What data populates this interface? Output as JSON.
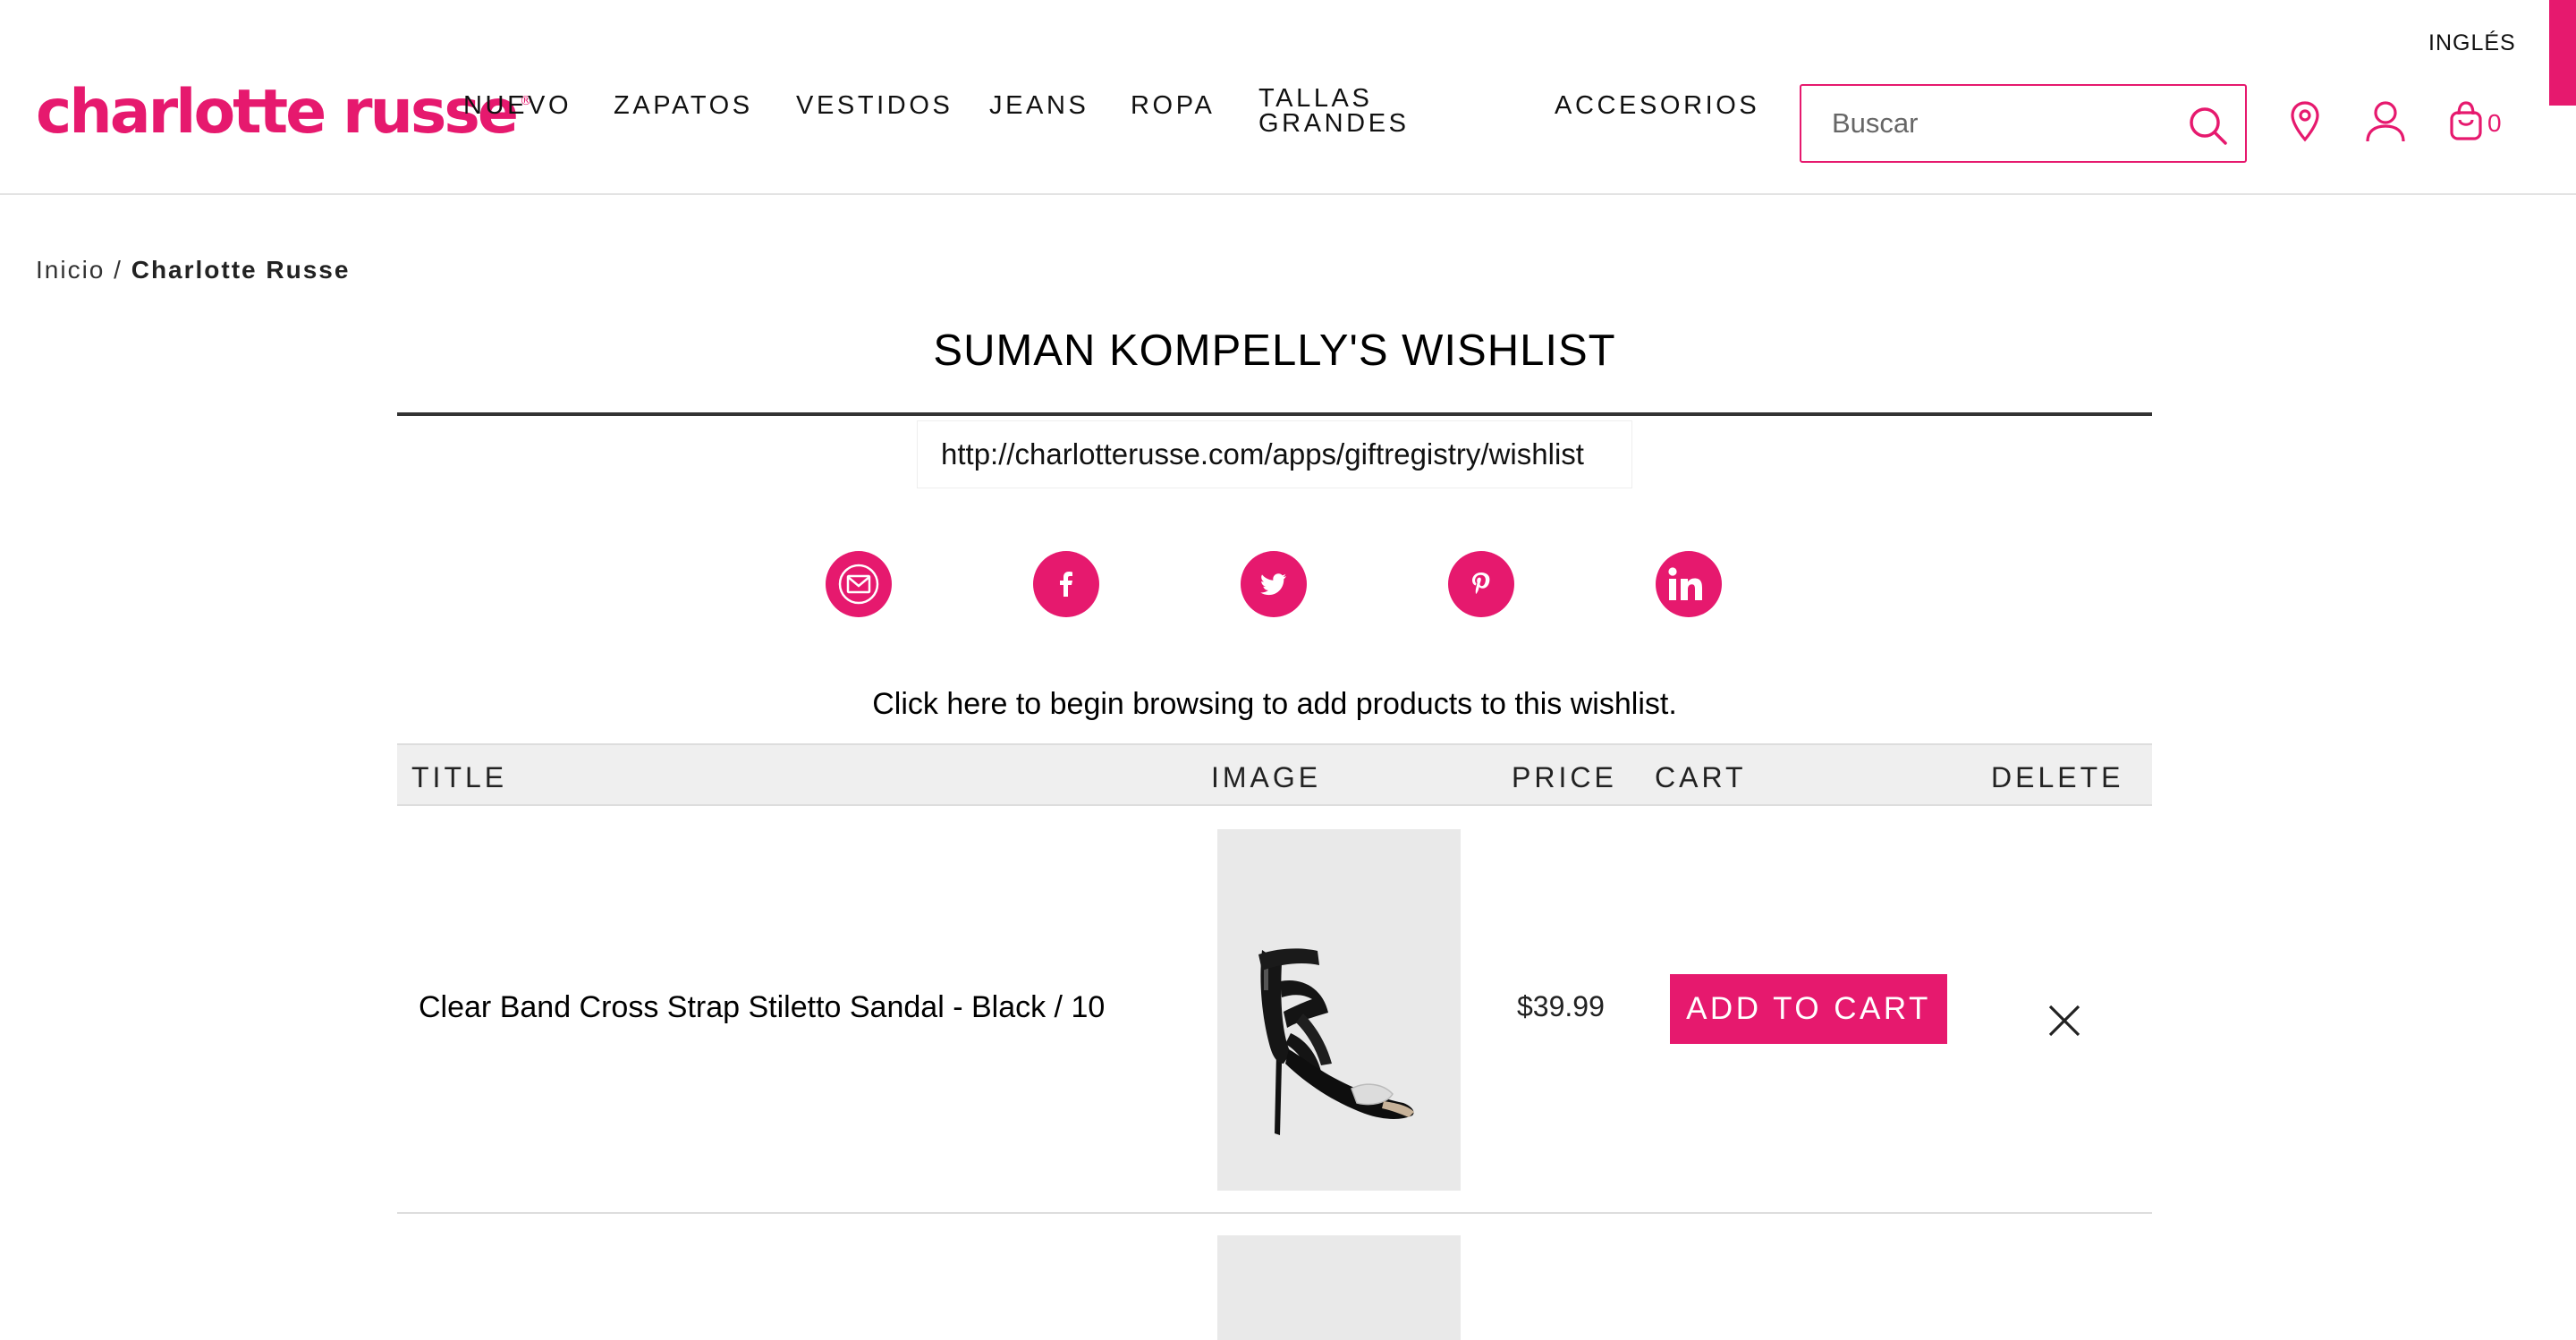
{
  "header": {
    "language": "INGLÉS",
    "logo_text": "charlotte russe",
    "logo_mark": "®",
    "nav": [
      "NUEVO",
      "ZAPATOS",
      "VESTIDOS",
      "JEANS",
      "ROPA",
      "TALLAS GRANDES",
      "ACCESORIOS"
    ],
    "nav_two_line": [
      "TALLAS",
      "GRANDES"
    ],
    "search_placeholder": "Buscar",
    "cart_count": "0"
  },
  "breadcrumb": {
    "home": "Inicio",
    "separator": "/",
    "current": "Charlotte Russe"
  },
  "wishlist": {
    "title": "SUMAN KOMPELLY'S WISHLIST",
    "share_url": "http://charlotterusse.com/apps/giftregistry/wishlist",
    "browse_message": "Click here to begin browsing to add products to this wishlist.",
    "social": [
      "email-icon",
      "facebook-icon",
      "twitter-icon",
      "pinterest-icon",
      "linkedin-icon"
    ],
    "columns": [
      "TITLE",
      "IMAGE",
      "PRICE",
      "CART",
      "DELETE"
    ],
    "items": [
      {
        "title": "Clear Band Cross Strap Stiletto Sandal - Black / 10",
        "price": "$39.99",
        "cart_label": "ADD TO CART"
      }
    ]
  },
  "colors": {
    "brand_pink": "#e6196e",
    "table_header_bg": "#efefef"
  }
}
